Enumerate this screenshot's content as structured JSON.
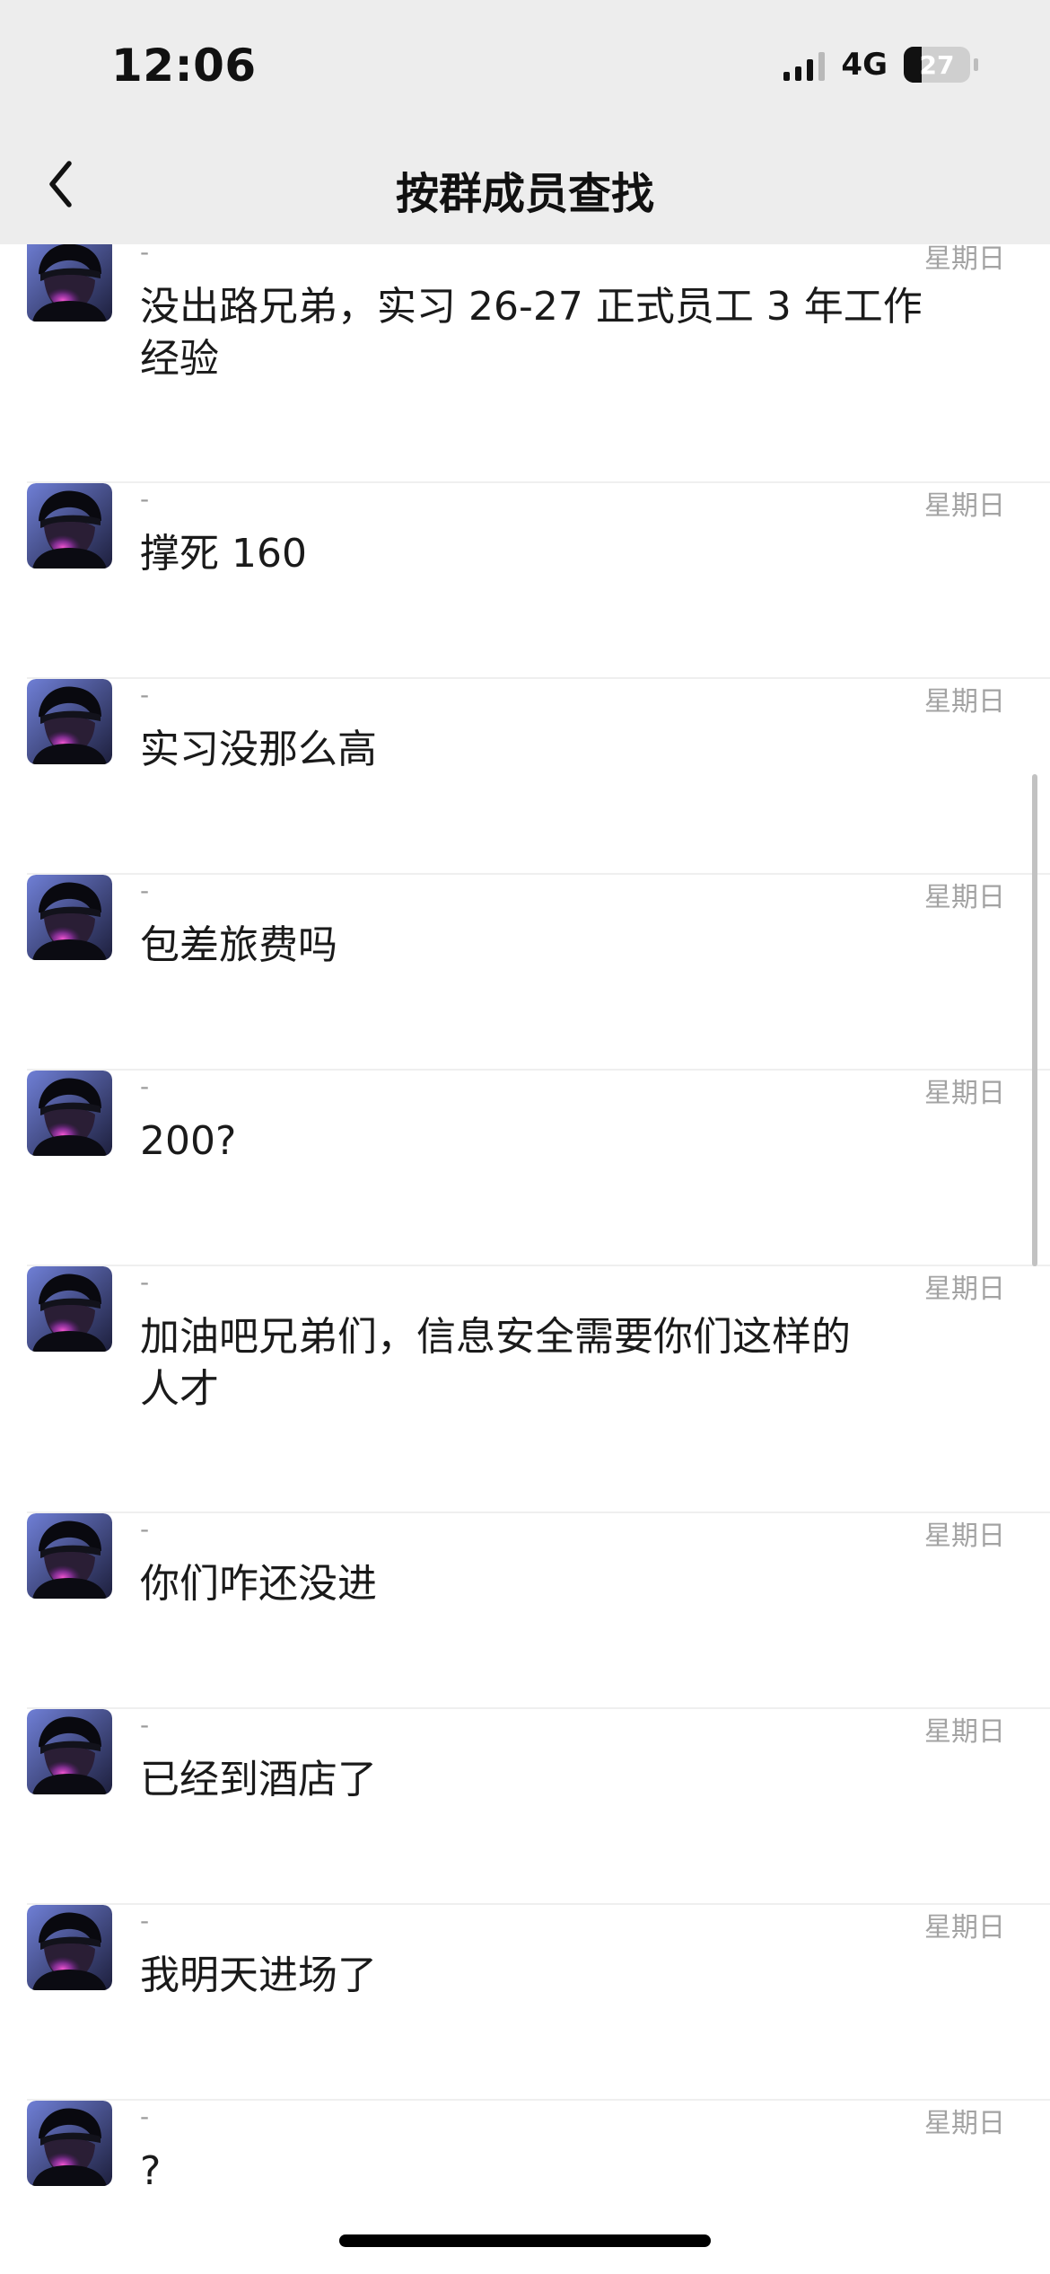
{
  "status_bar": {
    "time": "12:06",
    "network": "4G",
    "battery": "27",
    "battery_level": 0.27
  },
  "nav": {
    "title": "按群成员查找",
    "back_icon": "chevron-left-icon"
  },
  "messages": [
    {
      "sender": "-",
      "date": "星期日",
      "lines": [
        "没出路兄弟，实习 26-27 正式员工 3 年工作",
        "经验"
      ]
    },
    {
      "sender": "-",
      "date": "星期日",
      "lines": [
        "撑死 160"
      ]
    },
    {
      "sender": "-",
      "date": "星期日",
      "lines": [
        "实习没那么高"
      ]
    },
    {
      "sender": "-",
      "date": "星期日",
      "lines": [
        "包差旅费吗"
      ]
    },
    {
      "sender": "-",
      "date": "星期日",
      "lines": [
        "200?"
      ]
    },
    {
      "sender": "-",
      "date": "星期日",
      "lines": [
        "加油吧兄弟们，信息安全需要你们这样的",
        "人才"
      ]
    },
    {
      "sender": "-",
      "date": "星期日",
      "lines": [
        "你们咋还没进"
      ]
    },
    {
      "sender": "-",
      "date": "星期日",
      "lines": [
        "已经到酒店了"
      ]
    },
    {
      "sender": "-",
      "date": "星期日",
      "lines": [
        "我明天进场了"
      ]
    },
    {
      "sender": "-",
      "date": "星期日",
      "lines": [
        "?"
      ]
    }
  ],
  "colors": {
    "header_bg": "#ededed",
    "divider": "#efefef",
    "meta_text": "#a3a3a3",
    "message_text": "#1a1a1a"
  }
}
